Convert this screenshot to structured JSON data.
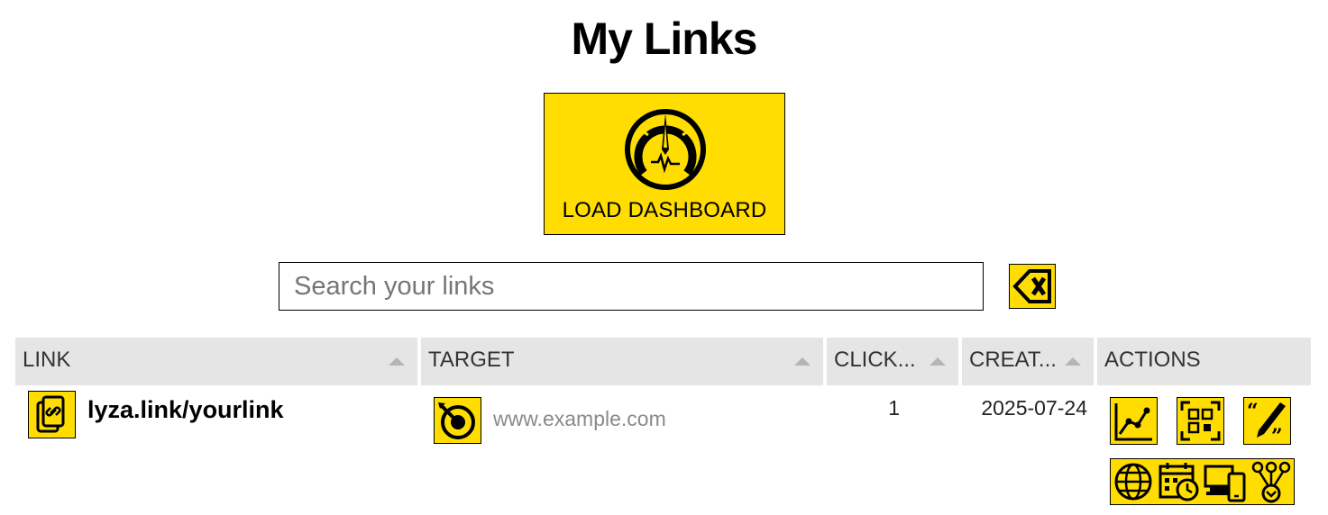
{
  "page": {
    "title": "My Links"
  },
  "dashboard": {
    "label": "LOAD DASHBOARD",
    "icon": "speedometer-gauge-icon"
  },
  "search": {
    "placeholder": "Search your links",
    "value": "",
    "clear_icon": "clear-backspace-icon"
  },
  "colors": {
    "accent": "#ffdd00",
    "header_bg": "#e5e5e5",
    "muted_text": "#8a8a8a"
  },
  "table": {
    "columns": [
      {
        "label": "LINK",
        "sortable": true
      },
      {
        "label": "TARGET",
        "sortable": true
      },
      {
        "label": "CLICK...",
        "sortable": true
      },
      {
        "label": "CREAT...",
        "sortable": true
      },
      {
        "label": "ACTIONS",
        "sortable": false
      }
    ],
    "rows": [
      {
        "link": "lyza.link/yourlink",
        "link_icon": "copy-link-icon",
        "target": "www.example.com",
        "target_icon": "target-icon",
        "clicks": "1",
        "created": "2025-07-24",
        "actions": [
          "stats-chart-icon",
          "qr-code-icon",
          "edit-quote-icon"
        ],
        "stats_filters": [
          "globe-icon",
          "calendar-clock-icon",
          "devices-icon",
          "referrer-network-icon"
        ]
      }
    ]
  }
}
